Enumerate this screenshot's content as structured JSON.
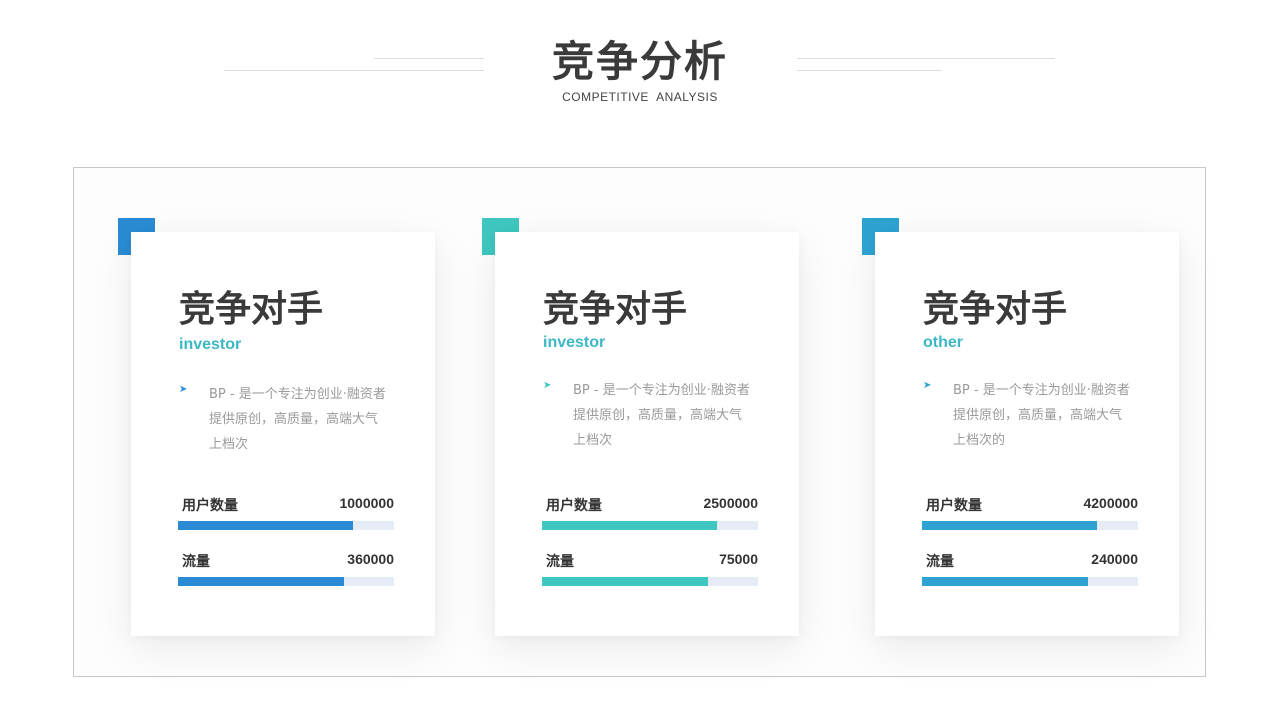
{
  "header": {
    "title": "竞争分析",
    "subtitle": "COMPETITIVE  ANALYSIS"
  },
  "cards": [
    {
      "title": "竞争对手",
      "subtitle": "investor",
      "accent": "#2a8bd4",
      "sub_color": "#3bb8c4",
      "bullet_icon": "arrow-bullet-icon",
      "description": "BP - 是一个专注为创业·融资者提供原创，高质量，高端大气上档次",
      "stats": [
        {
          "label": "用户数量",
          "value": "1000000",
          "fill": 0.81
        },
        {
          "label": "流量",
          "value": "360000",
          "fill": 0.77
        }
      ]
    },
    {
      "title": "竞争对手",
      "subtitle": "investor",
      "accent": "#3ec7c0",
      "sub_color": "#3bb8c4",
      "bullet_icon": "arrow-bullet-icon",
      "description": "BP - 是一个专注为创业·融资者提供原创，高质量，高端大气上档次",
      "stats": [
        {
          "label": "用户数量",
          "value": "2500000",
          "fill": 0.81
        },
        {
          "label": "流量",
          "value": "75000",
          "fill": 0.77
        }
      ]
    },
    {
      "title": "竞争对手",
      "subtitle": "other",
      "accent": "#2ea3d2",
      "sub_color": "#3bb8c4",
      "bullet_icon": "arrow-bullet-icon",
      "description": "BP - 是一个专注为创业·融资者提供原创，高质量，高端大气上档次的",
      "stats": [
        {
          "label": "用户数量",
          "value": "4200000",
          "fill": 0.81
        },
        {
          "label": "流量",
          "value": "240000",
          "fill": 0.77
        }
      ]
    }
  ]
}
